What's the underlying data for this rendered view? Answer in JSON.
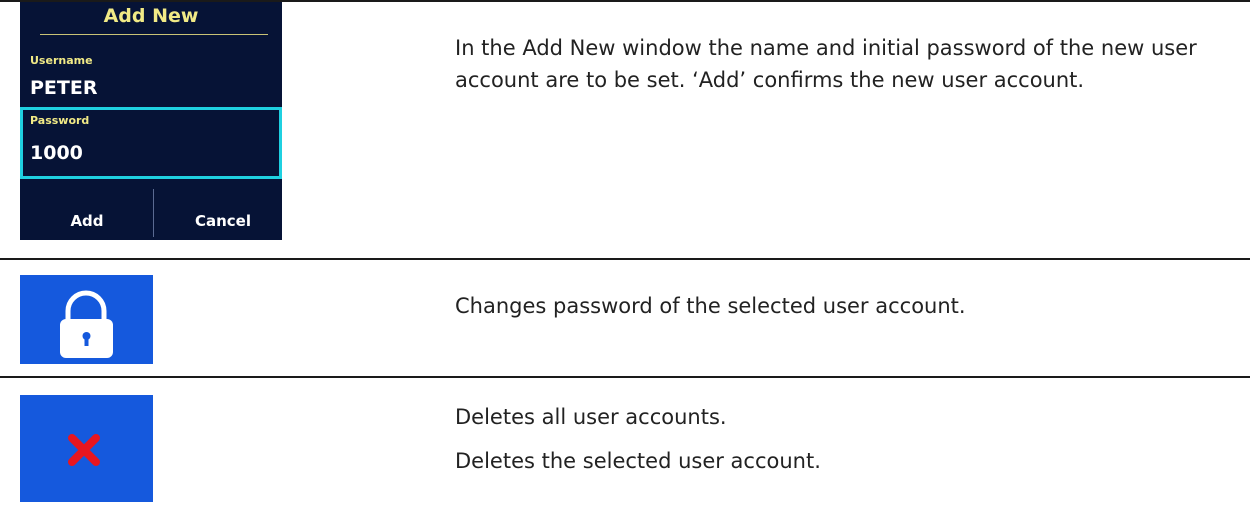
{
  "dialog": {
    "title": "Add New",
    "username_label": "Username",
    "username_value": "PETER",
    "password_label": "Password",
    "password_value": "1000",
    "add_button": "Add",
    "cancel_button": "Cancel",
    "colors": {
      "background": "#061336",
      "label": "#f1ea86",
      "focus_border": "#1fd0e0"
    }
  },
  "rows": [
    {
      "icon": null,
      "lines": [
        "In the Add New window the name and initial password of the new user account are to be set. ‘Add’ confirms the new user account."
      ]
    },
    {
      "icon": "lock-icon",
      "lines": [
        "Changes password of the selected user account."
      ]
    },
    {
      "icon": "delete-x-icon",
      "lines": [
        "Deletes all user accounts.",
        "Deletes the selected user account."
      ]
    }
  ],
  "colors": {
    "icon_tile": "#1559dd",
    "delete_x": "#e81620"
  }
}
